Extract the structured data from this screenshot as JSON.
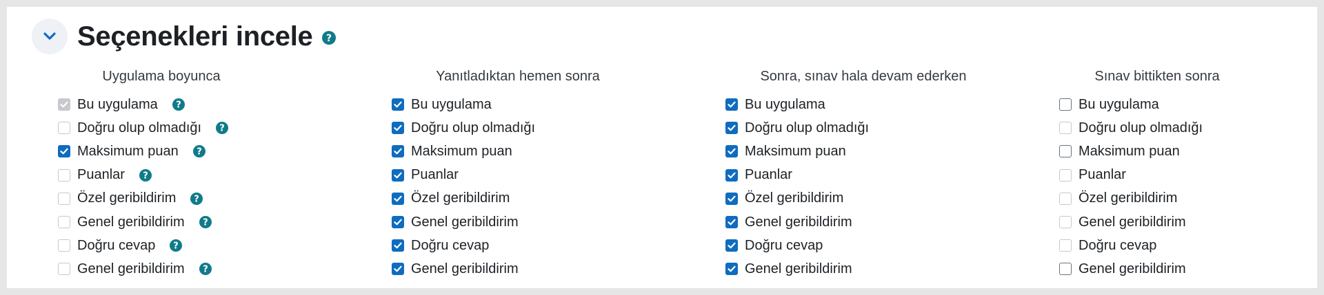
{
  "section": {
    "title": "Seçenekleri incele",
    "collapse_icon": "chevron-down-icon"
  },
  "colors": {
    "accent": "#0f6cbf",
    "help_icon": "#0f7b8a"
  },
  "columns": [
    {
      "header": "Uygulama boyunca",
      "items": [
        {
          "label": "Bu uygulama",
          "checked": true,
          "disabled": true,
          "help": true
        },
        {
          "label": "Doğru olup olmadığı",
          "checked": false,
          "help": true
        },
        {
          "label": "Maksimum puan",
          "checked": true,
          "help": true
        },
        {
          "label": "Puanlar",
          "checked": false,
          "help": true
        },
        {
          "label": "Özel geribildirim",
          "checked": false,
          "help": true
        },
        {
          "label": "Genel geribildirim",
          "checked": false,
          "help": true
        },
        {
          "label": "Doğru cevap",
          "checked": false,
          "help": true
        },
        {
          "label": "Genel geribildirim",
          "checked": false,
          "help": true
        }
      ]
    },
    {
      "header": "Yanıtladıktan hemen sonra",
      "items": [
        {
          "label": "Bu uygulama",
          "checked": true
        },
        {
          "label": "Doğru olup olmadığı",
          "checked": true
        },
        {
          "label": "Maksimum puan",
          "checked": true
        },
        {
          "label": "Puanlar",
          "checked": true
        },
        {
          "label": "Özel geribildirim",
          "checked": true
        },
        {
          "label": "Genel geribildirim",
          "checked": true
        },
        {
          "label": "Doğru cevap",
          "checked": true
        },
        {
          "label": "Genel geribildirim",
          "checked": true
        }
      ]
    },
    {
      "header": "Sonra, sınav hala devam ederken",
      "items": [
        {
          "label": "Bu uygulama",
          "checked": true
        },
        {
          "label": "Doğru olup olmadığı",
          "checked": true
        },
        {
          "label": "Maksimum puan",
          "checked": true
        },
        {
          "label": "Puanlar",
          "checked": true
        },
        {
          "label": "Özel geribildirim",
          "checked": true
        },
        {
          "label": "Genel geribildirim",
          "checked": true
        },
        {
          "label": "Doğru cevap",
          "checked": true
        },
        {
          "label": "Genel geribildirim",
          "checked": true
        }
      ]
    },
    {
      "header": "Sınav bittikten sonra",
      "items": [
        {
          "label": "Bu uygulama",
          "checked": false,
          "dark": true
        },
        {
          "label": "Doğru olup olmadığı",
          "checked": false
        },
        {
          "label": "Maksimum puan",
          "checked": false,
          "dark": true
        },
        {
          "label": "Puanlar",
          "checked": false
        },
        {
          "label": "Özel geribildirim",
          "checked": false
        },
        {
          "label": "Genel geribildirim",
          "checked": false
        },
        {
          "label": "Doğru cevap",
          "checked": false
        },
        {
          "label": "Genel geribildirim",
          "checked": false,
          "dark": true
        }
      ]
    }
  ]
}
